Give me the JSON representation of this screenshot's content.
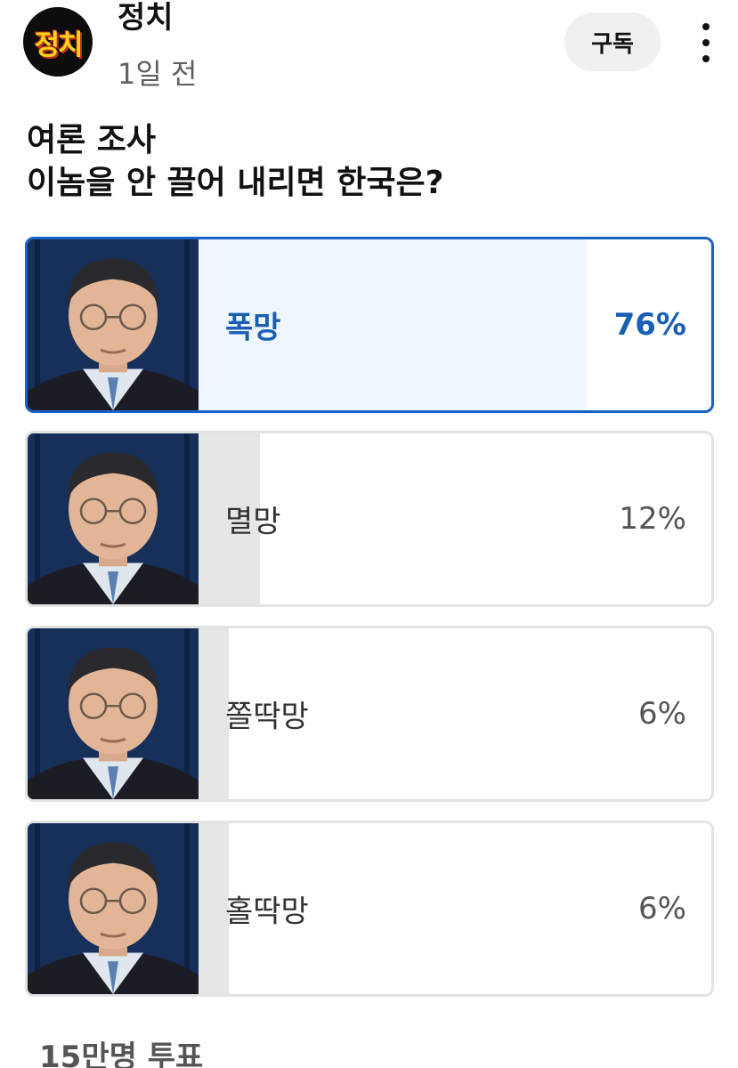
{
  "header": {
    "avatar_text": "정치",
    "channel_name": "정치",
    "post_time": "1일 전",
    "subscribe_label": "구독",
    "more_icon": "more-vertical-icon"
  },
  "post": {
    "title_line1": "여론 조사",
    "title_line2": "이놈을 안 끌어 내리면 한국은?"
  },
  "poll": {
    "options": [
      {
        "label": "폭망",
        "percent_text": "76%",
        "percent": 76,
        "selected": true
      },
      {
        "label": "멸망",
        "percent_text": "12%",
        "percent": 12,
        "selected": false
      },
      {
        "label": "쫄딱망",
        "percent_text": "6%",
        "percent": 6,
        "selected": false
      },
      {
        "label": "홀딱망",
        "percent_text": "6%",
        "percent": 6,
        "selected": false
      }
    ],
    "vote_count": "15만명 투표"
  },
  "colors": {
    "selected_border": "#1a63c4",
    "selected_text": "#1a5fb4",
    "selected_fill": "#eef6ff",
    "unselected_fill": "#e6e6e6",
    "avatar_text": "#f7d21b"
  }
}
